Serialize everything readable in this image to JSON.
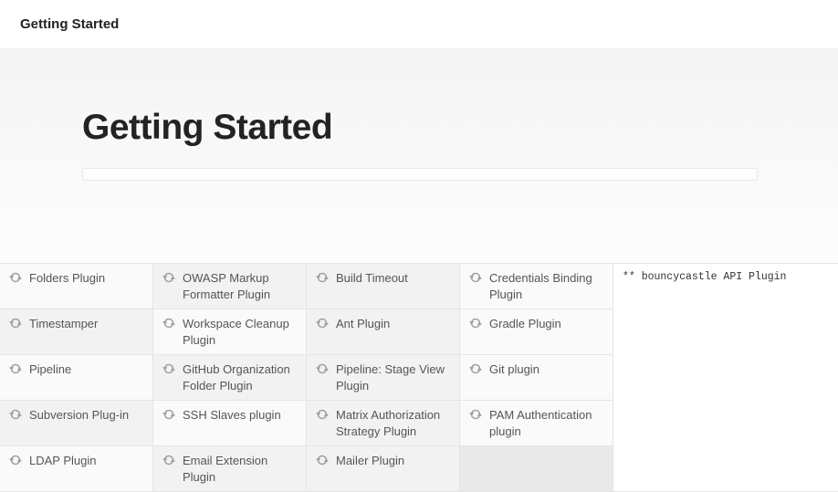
{
  "header": {
    "title": "Getting Started"
  },
  "main": {
    "title": "Getting Started"
  },
  "plugins": {
    "rows": [
      [
        {
          "name": "Folders Plugin",
          "style": "alt"
        },
        {
          "name": "OWASP Markup Formatter Plugin",
          "style": "normal"
        },
        {
          "name": "Build Timeout",
          "style": "normal"
        },
        {
          "name": "Credentials Binding Plugin",
          "style": "alt"
        }
      ],
      [
        {
          "name": "Timestamper",
          "style": "normal"
        },
        {
          "name": "Workspace Cleanup Plugin",
          "style": "alt"
        },
        {
          "name": "Ant Plugin",
          "style": "normal"
        },
        {
          "name": "Gradle Plugin",
          "style": "alt"
        }
      ],
      [
        {
          "name": "Pipeline",
          "style": "alt"
        },
        {
          "name": "GitHub Organization Folder Plugin",
          "style": "normal"
        },
        {
          "name": "Pipeline: Stage View Plugin",
          "style": "normal"
        },
        {
          "name": "Git plugin",
          "style": "alt"
        }
      ],
      [
        {
          "name": "Subversion Plug-in",
          "style": "normal"
        },
        {
          "name": "SSH Slaves plugin",
          "style": "alt"
        },
        {
          "name": "Matrix Authorization Strategy Plugin",
          "style": "normal"
        },
        {
          "name": "PAM Authentication plugin",
          "style": "alt"
        }
      ],
      [
        {
          "name": "LDAP Plugin",
          "style": "alt"
        },
        {
          "name": "Email Extension Plugin",
          "style": "normal"
        },
        {
          "name": "Mailer Plugin",
          "style": "normal"
        },
        {
          "name": "",
          "style": "empty"
        }
      ]
    ]
  },
  "log": {
    "lines": [
      "** bouncycastle API Plugin"
    ]
  }
}
